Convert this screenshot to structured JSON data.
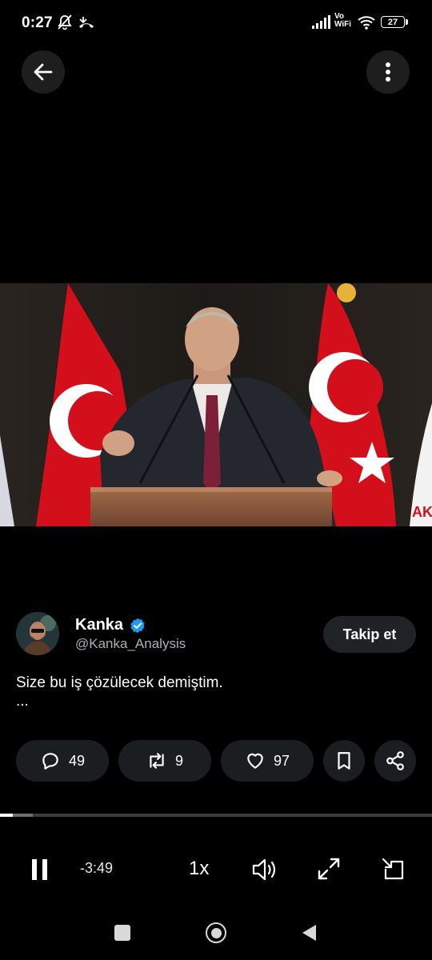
{
  "status_bar": {
    "time": "0:27",
    "network_label_top": "Vo",
    "network_label_bottom": "WiFi",
    "battery": "27"
  },
  "top_bar": {
    "back_icon": "arrow-left-icon",
    "menu_icon": "more-vertical-icon"
  },
  "video": {
    "banner_text": "AK"
  },
  "author": {
    "name": "Kanka",
    "handle": "@Kanka_Analysis",
    "verified": true,
    "follow_label": "Takip et"
  },
  "tweet": {
    "text": "Size bu iş çözülecek demiştim.",
    "more": "..."
  },
  "actions": {
    "replies": "49",
    "retweets": "9",
    "likes": "97"
  },
  "player": {
    "remaining": "-3:49",
    "speed": "1x",
    "progress_played": 0.03,
    "progress_buffered": 0.075
  },
  "colors": {
    "verified": "#1d9bf0",
    "pill_bg": "#1b1e21",
    "flag_red": "#e30a17"
  }
}
